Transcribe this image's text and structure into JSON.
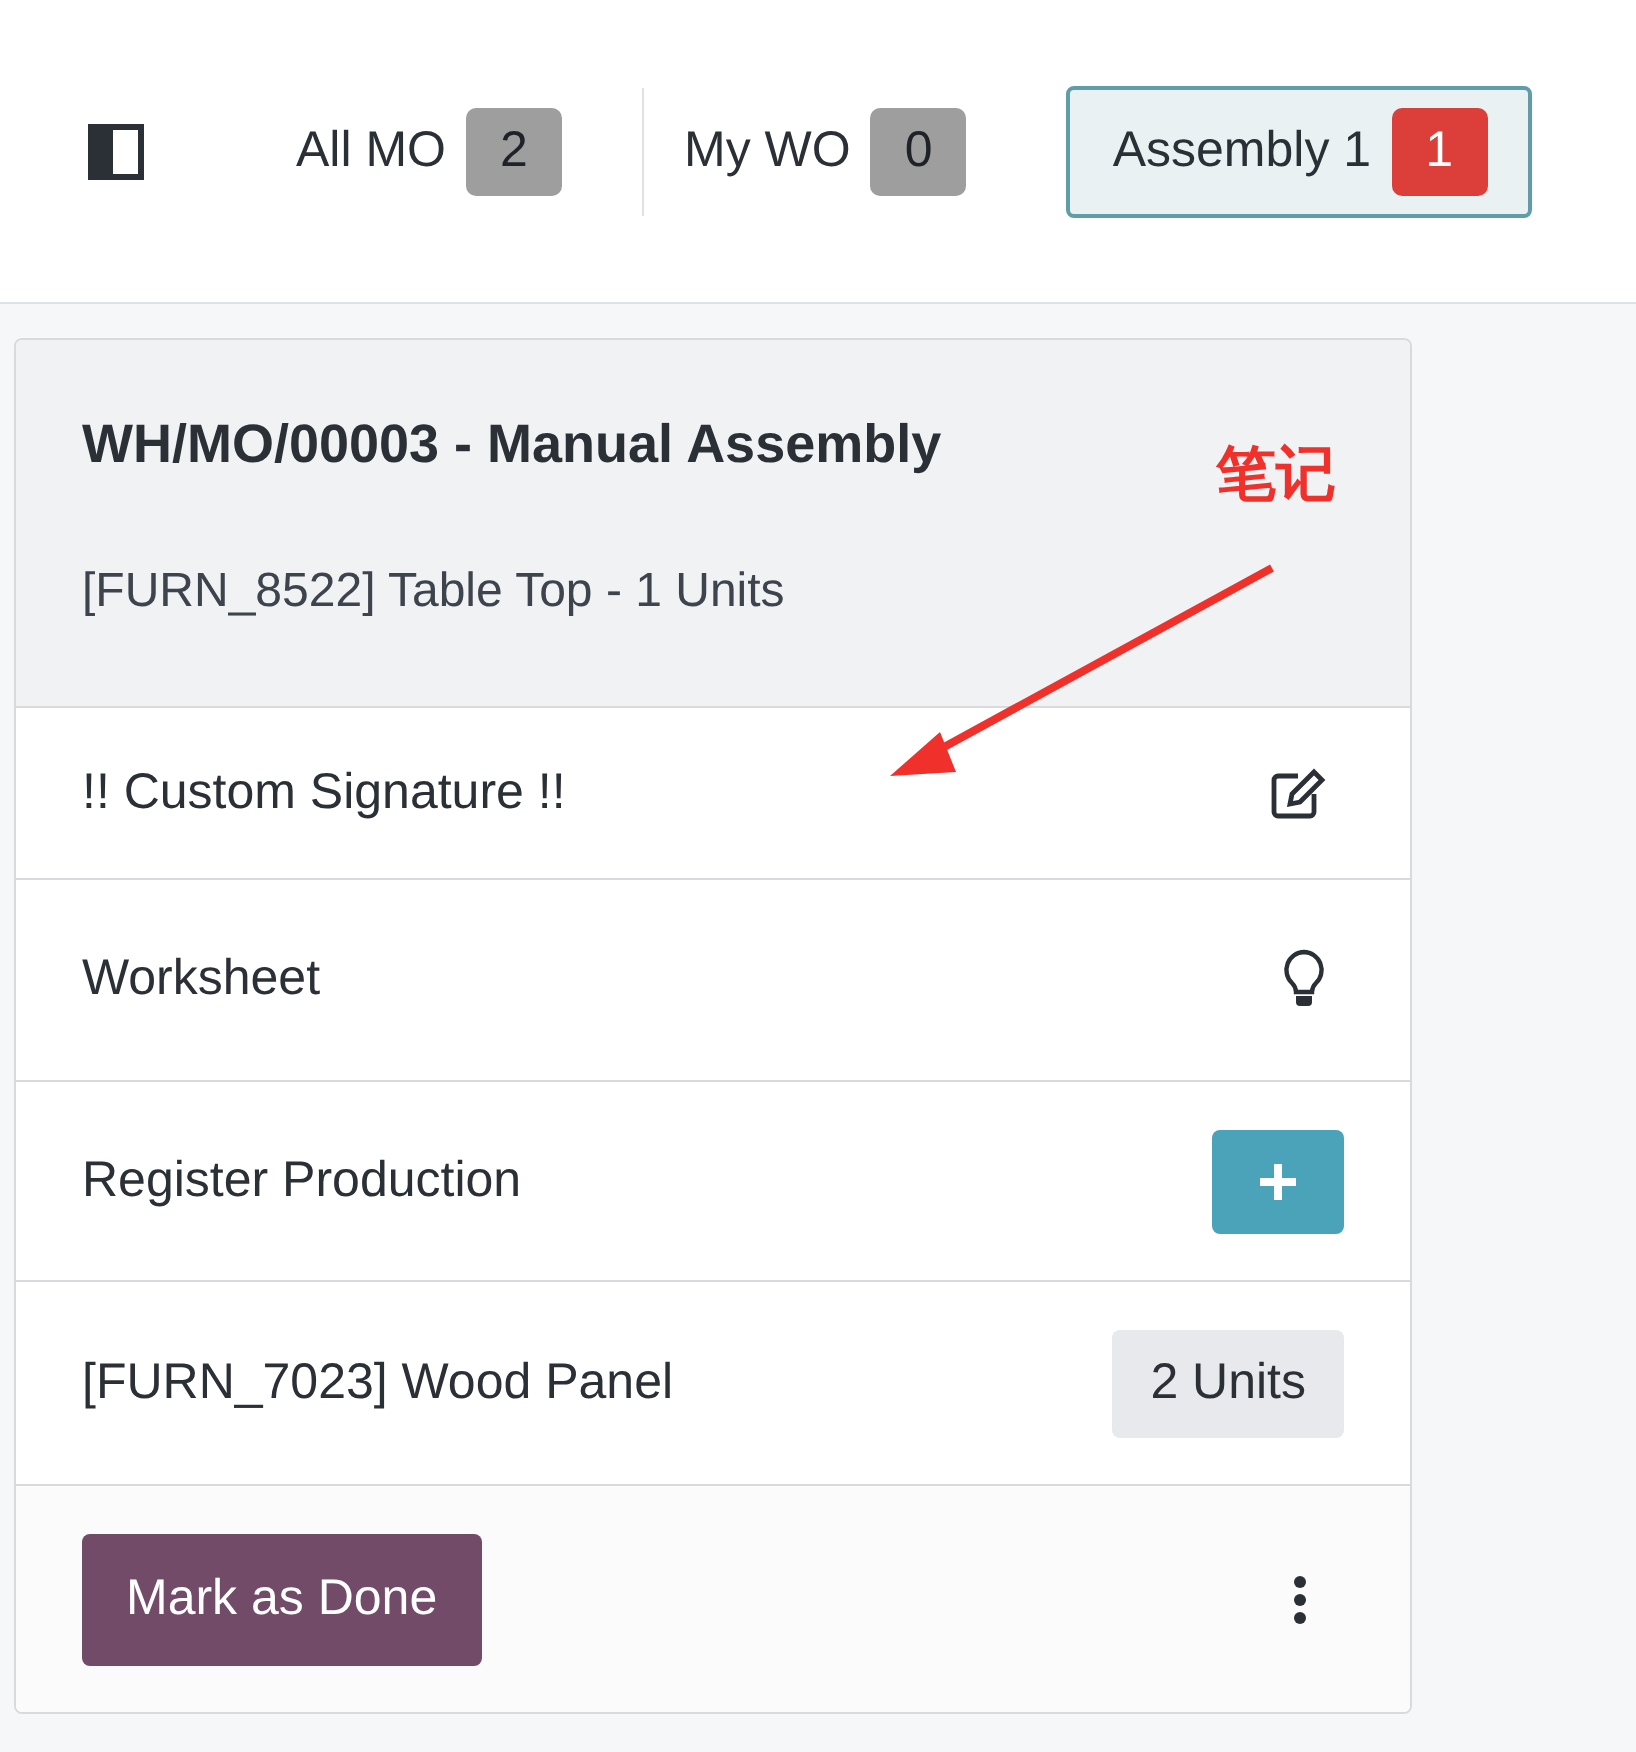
{
  "topbar": {
    "tabs": [
      {
        "label": "All MO",
        "count": "2",
        "selected": false,
        "color": "#9e9e9e"
      },
      {
        "label": "My WO",
        "count": "0",
        "selected": false,
        "color": "#9e9e9e"
      },
      {
        "label": "Assembly 1",
        "count": "1",
        "selected": true,
        "color": "#dc3f3a"
      }
    ]
  },
  "card": {
    "title": "WH/MO/00003 - Manual Assembly",
    "subtitle": "[FURN_8522] Table Top - 1 Units",
    "rows": [
      {
        "kind": "signature",
        "label": "!! Custom Signature !!"
      },
      {
        "kind": "worksheet",
        "label": "Worksheet"
      },
      {
        "kind": "register",
        "label": "Register Production"
      },
      {
        "kind": "component",
        "label": "[FURN_7023] Wood Panel",
        "quantity": "2 Units"
      }
    ],
    "footer": {
      "button": "Mark as Done"
    }
  },
  "annotation": {
    "text": "笔记"
  }
}
